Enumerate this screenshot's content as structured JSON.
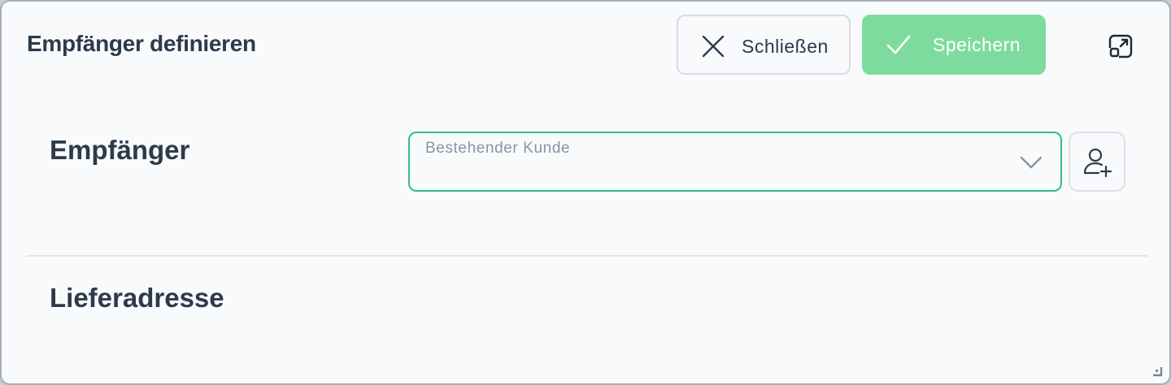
{
  "dialog": {
    "title": "Empfänger definieren"
  },
  "toolbar": {
    "close_label": "Schließen",
    "save_label": "Speichern",
    "close_icon": "close-icon",
    "save_icon": "check-icon",
    "expand_icon": "expand-icon"
  },
  "recipient": {
    "heading": "Empfänger",
    "select_placeholder": "Bestehender Kunde",
    "add_icon": "add-user-icon"
  },
  "delivery": {
    "heading": "Lieferadresse"
  },
  "colors": {
    "save_button": "#7ddc9d",
    "select_border": "#2fbf7e",
    "text": "#2d3a4b"
  }
}
